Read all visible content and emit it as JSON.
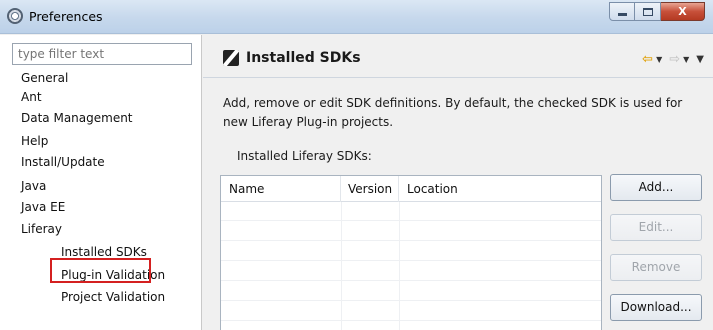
{
  "window": {
    "title": "Preferences",
    "buttons": {
      "minimize": "",
      "maximize": "",
      "close": "X"
    }
  },
  "sidebar": {
    "filter_placeholder": "type filter text",
    "items": [
      {
        "label": "General",
        "level": 0
      },
      {
        "label": "Ant",
        "level": 0
      },
      {
        "label": "Data Management",
        "level": 0
      },
      {
        "label": "Help",
        "level": 0
      },
      {
        "label": "Install/Update",
        "level": 0
      },
      {
        "label": "Java",
        "level": 0
      },
      {
        "label": "Java EE",
        "level": 0
      },
      {
        "label": "Liferay",
        "level": 0
      },
      {
        "label": "Installed SDKs",
        "level": 1,
        "selected": true
      },
      {
        "label": "Plug-in Validation",
        "level": 1
      },
      {
        "label": "Project Validation",
        "level": 1
      }
    ]
  },
  "page": {
    "title": "Installed SDKs",
    "description": "Add, remove or edit SDK definitions. By default, the checked SDK is used for new Liferay Plug-in projects.",
    "table_label": "Installed Liferay SDKs:",
    "columns": [
      "Name",
      "Version",
      "Location"
    ],
    "rows": []
  },
  "buttons": {
    "add": "Add...",
    "edit": "Edit...",
    "remove": "Remove",
    "download": "Download..."
  },
  "colors": {
    "selection_outline": "#d42020",
    "nav_back_arrow": "#e1a515"
  },
  "icons": {
    "window": "preferences-app-icon",
    "page": "sdk-icon",
    "nav_back": "arrow-left-icon",
    "nav_forward": "arrow-right-icon"
  }
}
